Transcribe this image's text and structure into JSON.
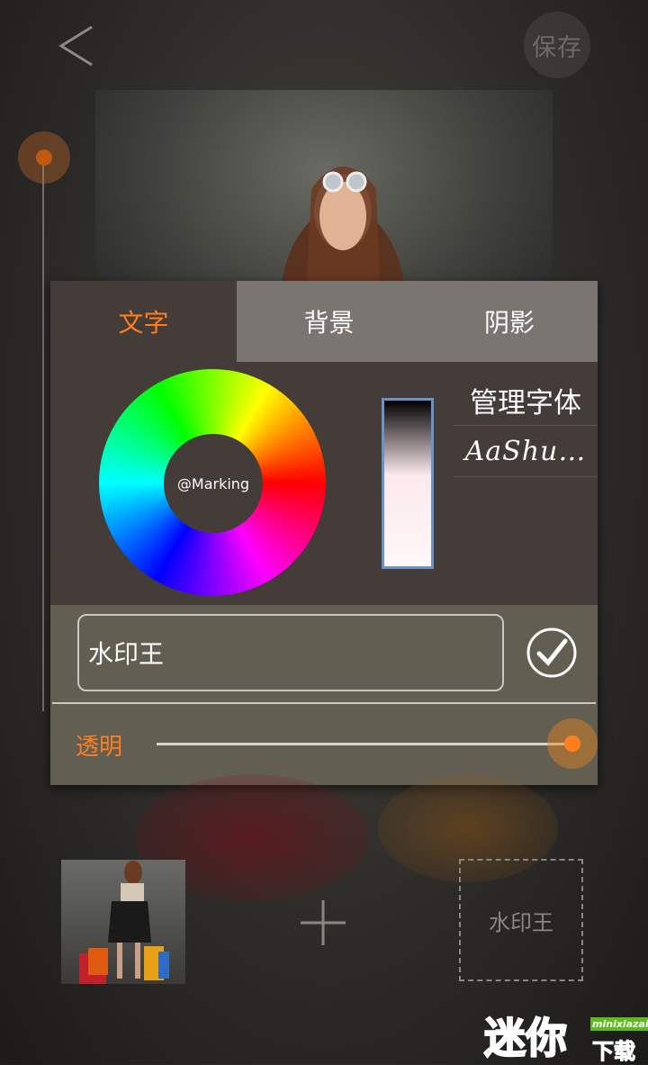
{
  "header": {
    "save_label": "保存"
  },
  "panel": {
    "tabs": [
      {
        "label": "文字",
        "active": true
      },
      {
        "label": "背景",
        "active": false
      },
      {
        "label": "阴影",
        "active": false
      }
    ],
    "wheel_center_label": "@Marking",
    "font_manage_label": "管理字体",
    "font_current": "AaShu…",
    "text_value": "水印王",
    "opacity_label": "透明",
    "opacity_value": 1.0
  },
  "bottom": {
    "watermark_preview": "水印王"
  },
  "branding": {
    "logo_cn": "迷你",
    "logo_en": "minixiazai",
    "logo_sub": "下载"
  },
  "colors": {
    "accent": "#ff7f1e",
    "panel_bg": "#433c39",
    "tab_inactive": "#7b7572",
    "text_area_bg": "#625f52"
  },
  "icons": [
    "back-arrow-icon",
    "checkmark-icon",
    "plus-icon",
    "color-wheel"
  ]
}
